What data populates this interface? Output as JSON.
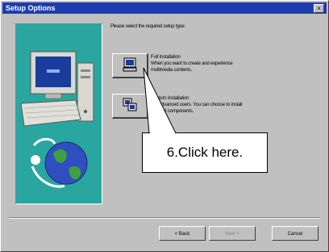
{
  "window": {
    "title": "Setup Options",
    "close_glyph": "×"
  },
  "main": {
    "prompt": "Please select the required setup type:",
    "options": [
      {
        "title": "Full Installation",
        "description": [
          "When you want to create and experience",
          "multimedia contents."
        ],
        "icon": "computer-icon"
      },
      {
        "title": "Custom Installation",
        "description": [
          "For advanced users. You can choose to install",
          "optional components."
        ],
        "icon": "custom-install-icon"
      }
    ]
  },
  "footer": {
    "back_label": "< Back",
    "next_label": "Next >",
    "cancel_label": "Cancel"
  },
  "callout": {
    "text": "6.Click here."
  },
  "colors": {
    "titlebar": "#1f3cae",
    "panel": "#2aa6a1",
    "face": "#c0c0c0"
  }
}
